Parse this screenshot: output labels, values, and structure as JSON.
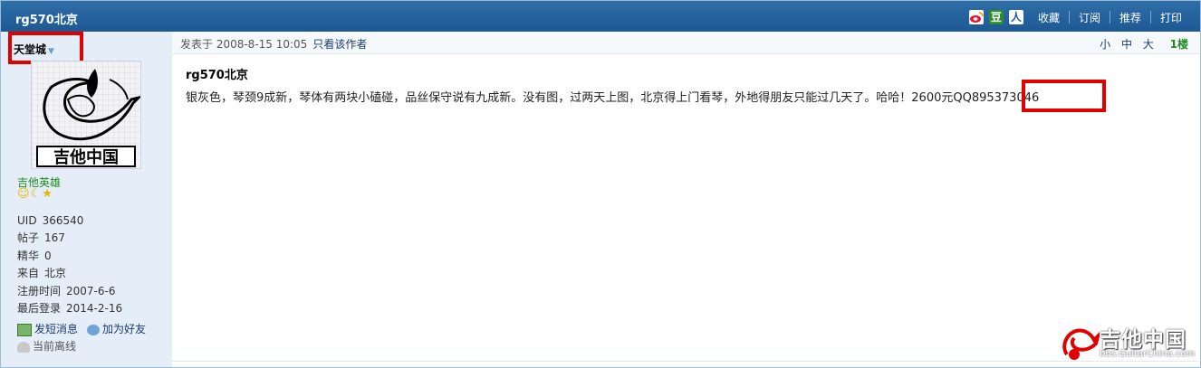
{
  "thread": {
    "title": "rg570北京"
  },
  "toolbar": {
    "weibo_icon": "weibo-icon",
    "douban_label": "豆",
    "renren_label": "人",
    "favorite": "收藏",
    "subscribe": "订阅",
    "recommend": "推荐",
    "print": "打印"
  },
  "author": {
    "name": "天堂城",
    "avatar_text": "吉他中国",
    "group": "吉他英雄",
    "fields": [
      {
        "key": "UID",
        "value": "366540"
      },
      {
        "key": "帖子",
        "value": "167"
      },
      {
        "key": "精华",
        "value": "0"
      },
      {
        "key": "来自",
        "value": "北京"
      },
      {
        "key": "注册时间",
        "value": "2007-6-6"
      },
      {
        "key": "最后登录",
        "value": "2014-2-16"
      }
    ],
    "send_message": "发短消息",
    "add_friend": "加为好友",
    "status": "当前离线"
  },
  "post": {
    "posted_at": "发表于 2008-8-15 10:05",
    "author_only": "只看该作者",
    "font_small": "小",
    "font_medium": "中",
    "font_large": "大",
    "floor": "1楼",
    "subject": "rg570北京",
    "body": "银灰色，琴颈9成新，琴体有两块小磕碰，品丝保守说有九成新。没有图，过两天上图，北京得上门看琴，外地得朋友只能过几天了。哈哈！2600元QQ895373046"
  },
  "watermark": {
    "text": "吉他中国",
    "url": "bbs.GuitarChina.com"
  },
  "colors": {
    "titlebar": "#1d5893",
    "sidebar": "#e5eef8",
    "highlight_box": "#e10000",
    "group": "#1e8b1e"
  }
}
